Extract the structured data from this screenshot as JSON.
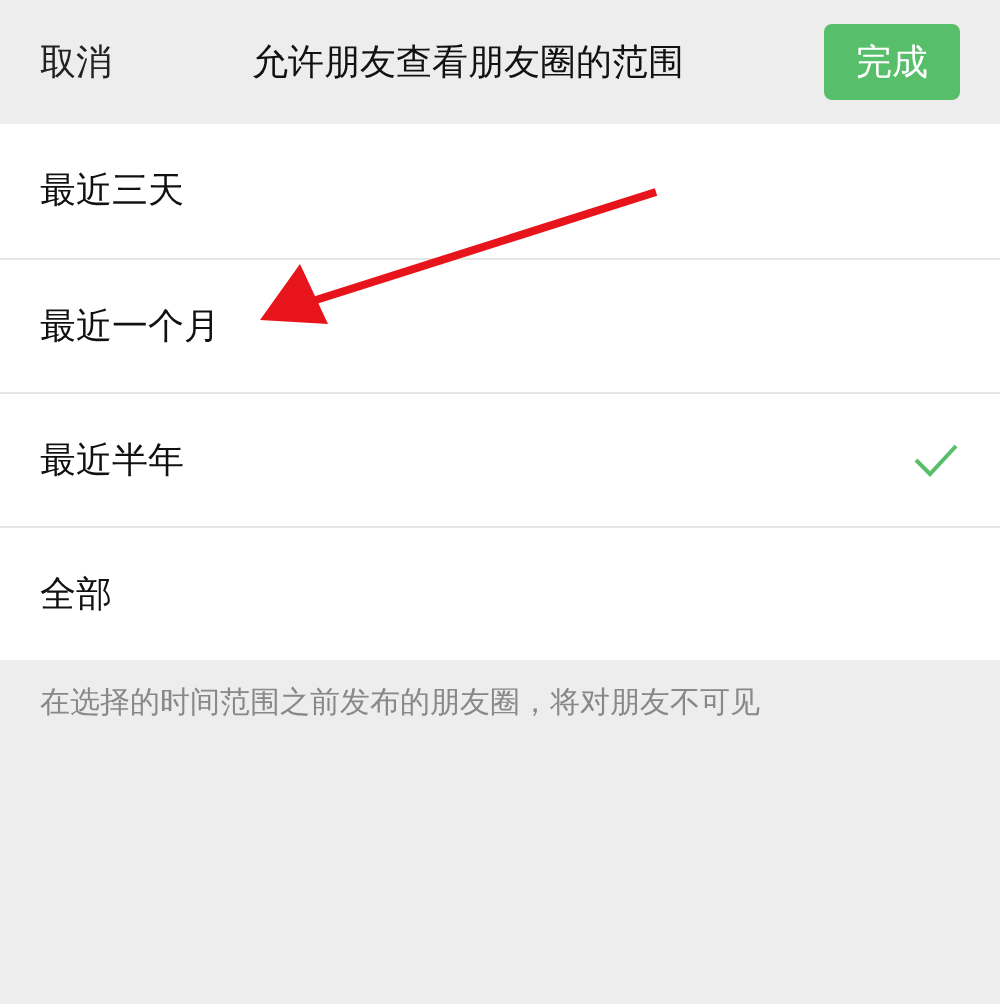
{
  "header": {
    "cancel": "取消",
    "title": "允许朋友查看朋友圈的范围",
    "done": "完成"
  },
  "options": [
    {
      "label": "最近三天",
      "selected": false
    },
    {
      "label": "最近一个月",
      "selected": false
    },
    {
      "label": "最近半年",
      "selected": true
    },
    {
      "label": "全部",
      "selected": false
    }
  ],
  "footnote": "在选择的时间范围之前发布的朋友圈，将对朋友不可见"
}
